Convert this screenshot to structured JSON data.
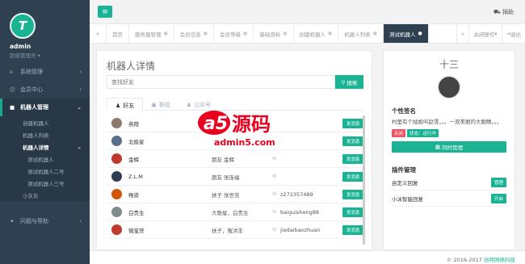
{
  "sidebar": {
    "logo_letter": "T",
    "user": "admin",
    "role": "超级管理员",
    "items": [
      {
        "label": "系统管理",
        "icon": "home-icon"
      },
      {
        "label": "会员中心",
        "icon": "user-icon"
      },
      {
        "label": "机器人管理",
        "icon": "robot-icon"
      }
    ],
    "robot_sub": [
      "创建机器人",
      "机器人列表",
      "机器人详情"
    ],
    "robot_detail_sub": [
      "测试机器人",
      "测试机器人二号",
      "测试机器人三号",
      "小灰灰"
    ],
    "help": "问题与帮助"
  },
  "topbar": {
    "menu_icon": "hamburger-icon",
    "donate": "捐助"
  },
  "tabs": {
    "items": [
      "首页",
      "服务器管理",
      "会员信息",
      "会员等级",
      "基础资料",
      "创建机器人",
      "机器人列表",
      "测试机器人"
    ],
    "active_index": 7,
    "close_ops": "关闭操作",
    "exit": "退出"
  },
  "main": {
    "title": "机器人详情",
    "search_placeholder": "查找好友",
    "search_btn": "搜索",
    "tabs": [
      "好友",
      "群组",
      "公众号"
    ],
    "send_label": "发消息",
    "rows": [
      {
        "name": "燕葭",
        "rel": "",
        "qq": "",
        "color": "#8d7a6b"
      },
      {
        "name": "北极星",
        "rel": "",
        "qq": "",
        "color": "#5a6f8a"
      },
      {
        "name": "金辉",
        "rel": "朋友 金辉",
        "qq": "",
        "color": "#c0392b"
      },
      {
        "name": "Z.L.M",
        "rel": "朋友 张连福",
        "qq": "",
        "color": "#2c3e50"
      },
      {
        "name": "畅资",
        "rel": "扶子 张世充",
        "qq": "z272357489",
        "color": "#d35400"
      },
      {
        "name": "白贵生",
        "rel": "大歌星，白贵生",
        "qq": "baiguisheng88",
        "color": "#7f8c8d"
      },
      {
        "name": "微宝贷",
        "rel": "扶子，冤洪丰",
        "qq": "jiedaibaozhuan",
        "color": "#c0392b"
      }
    ],
    "watermark_top": "a5源码",
    "watermark_bottom": "admin5.com"
  },
  "right": {
    "bot_name": "十三",
    "sign_title": "个性签名",
    "sign_text": "村里有个姑娘叫赵雪，。。一双美丽的大眼睛。。。",
    "badge_off": "关闭",
    "badge_status": "状态：运行中",
    "sync_btn": "同时管理",
    "plugin_title": "插件管理",
    "plugins": [
      {
        "name": "自定义回复",
        "btn": "管理"
      },
      {
        "name": "小冰智能回复",
        "btn": "开启"
      }
    ]
  },
  "footer": {
    "copyright": "© 2016-2017",
    "brand": "创特网络科技"
  }
}
